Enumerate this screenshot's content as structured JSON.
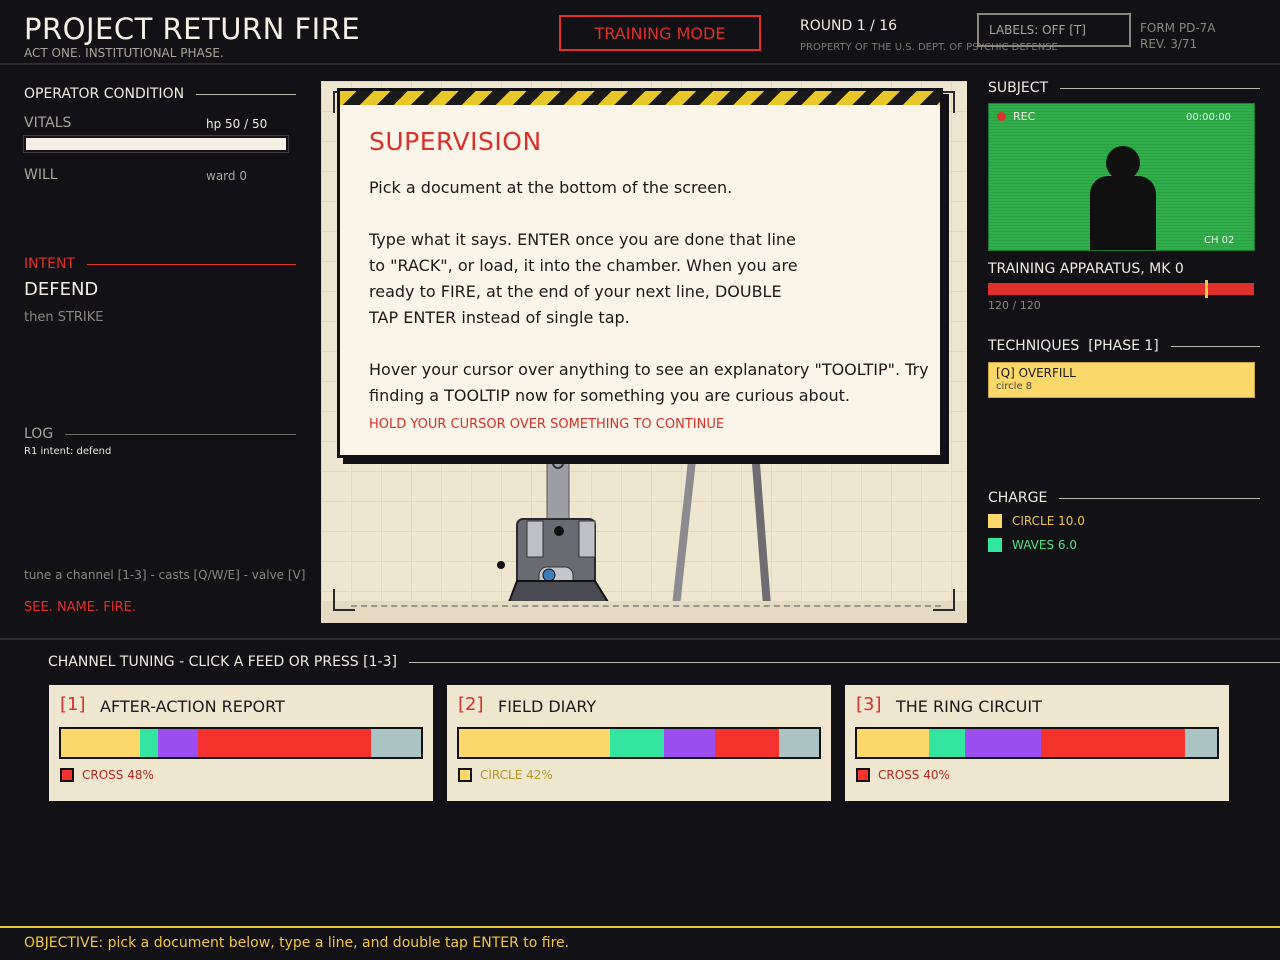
{
  "header": {
    "title": "PROJECT RETURN FIRE",
    "subtitle": "ACT ONE. INSTITUTIONAL PHASE.",
    "mode": "TRAINING MODE",
    "round": "ROUND 1 / 16",
    "property": "PROPERTY OF THE U.S. DEPT. OF PSYCHIC DEFENSE",
    "labels_toggle": "LABELS: OFF [T]",
    "form": "FORM PD-7A",
    "rev": "REV. 3/71"
  },
  "operator": {
    "heading": "OPERATOR CONDITION",
    "vitals_label": "VITALS",
    "hp": "hp 50 / 50",
    "hp_fraction": 1.0,
    "will_label": "WILL",
    "ward": "ward 0"
  },
  "intent": {
    "heading": "INTENT",
    "current": "DEFEND",
    "next": "then STRIKE"
  },
  "log": {
    "heading": "LOG",
    "entries": [
      "R1 intent: defend"
    ]
  },
  "footer_left": {
    "controls": "tune a channel [1-3] - casts [Q/W/E] - valve [V]",
    "slogan": "SEE. NAME. FIRE."
  },
  "modal": {
    "title": "SUPERVISION",
    "p1": "Pick a document at the bottom of the screen.",
    "p2": "Type what it says. ENTER once you are done that line to \"RACK\", or load, it into the chamber. When you are ready to FIRE, at the end of your next line, DOUBLE TAP ENTER instead of single tap.",
    "p3": "Hover your cursor over anything to see an explanatory \"TOOLTIP\". Try finding a TOOLTIP now for something you are curious about.",
    "cta": "HOLD YOUR CURSOR OVER SOMETHING TO CONTINUE"
  },
  "subject": {
    "heading": "SUBJECT",
    "rec": "REC",
    "timecode": "00:00:00",
    "channel": "CH 02",
    "apparatus": "TRAINING APPARATUS, MK 0",
    "apparatus_hp": "120 / 120",
    "apparatus_fraction": 1.0
  },
  "techniques": {
    "heading": "TECHNIQUES  [PHASE 1]",
    "items": [
      {
        "name": "[Q] OVERFILL",
        "sub": "circle 8"
      }
    ]
  },
  "charge": {
    "heading": "CHARGE",
    "items": [
      {
        "label": "CIRCLE 10.0",
        "color": "#f2c73e"
      },
      {
        "label": "WAVES 6.0",
        "color": "#4de385"
      }
    ]
  },
  "tuning": {
    "heading": "CHANNEL TUNING - CLICK A FEED OR PRESS [1-3]",
    "colors": {
      "circle": "#fcd86b",
      "waves": "#33e6a0",
      "violet": "#9b4ff0",
      "cross": "#f5332e",
      "blank": "#a9c4c2"
    },
    "cards": [
      {
        "num": "[1]",
        "title": "AFTER-ACTION REPORT",
        "dominant": "CROSS 48%",
        "dominant_color": "#f5332e",
        "text_color": "#b02a24",
        "segments": [
          {
            "k": "circle",
            "v": 22
          },
          {
            "k": "waves",
            "v": 5
          },
          {
            "k": "violet",
            "v": 11
          },
          {
            "k": "cross",
            "v": 48
          },
          {
            "k": "blank",
            "v": 14
          }
        ]
      },
      {
        "num": "[2]",
        "title": "FIELD DIARY",
        "dominant": "CIRCLE 42%",
        "dominant_color": "#fcd86b",
        "text_color": "#b8962c",
        "segments": [
          {
            "k": "circle",
            "v": 42
          },
          {
            "k": "waves",
            "v": 15
          },
          {
            "k": "violet",
            "v": 14
          },
          {
            "k": "cross",
            "v": 18
          },
          {
            "k": "blank",
            "v": 11
          }
        ]
      },
      {
        "num": "[3]",
        "title": "THE RING CIRCUIT",
        "dominant": "CROSS 40%",
        "dominant_color": "#f5332e",
        "text_color": "#b02a24",
        "segments": [
          {
            "k": "circle",
            "v": 20
          },
          {
            "k": "waves",
            "v": 10
          },
          {
            "k": "violet",
            "v": 21
          },
          {
            "k": "cross",
            "v": 40
          },
          {
            "k": "blank",
            "v": 9
          }
        ]
      }
    ]
  },
  "objective": "OBJECTIVE: pick a document below, type a line, and double tap ENTER to fire."
}
